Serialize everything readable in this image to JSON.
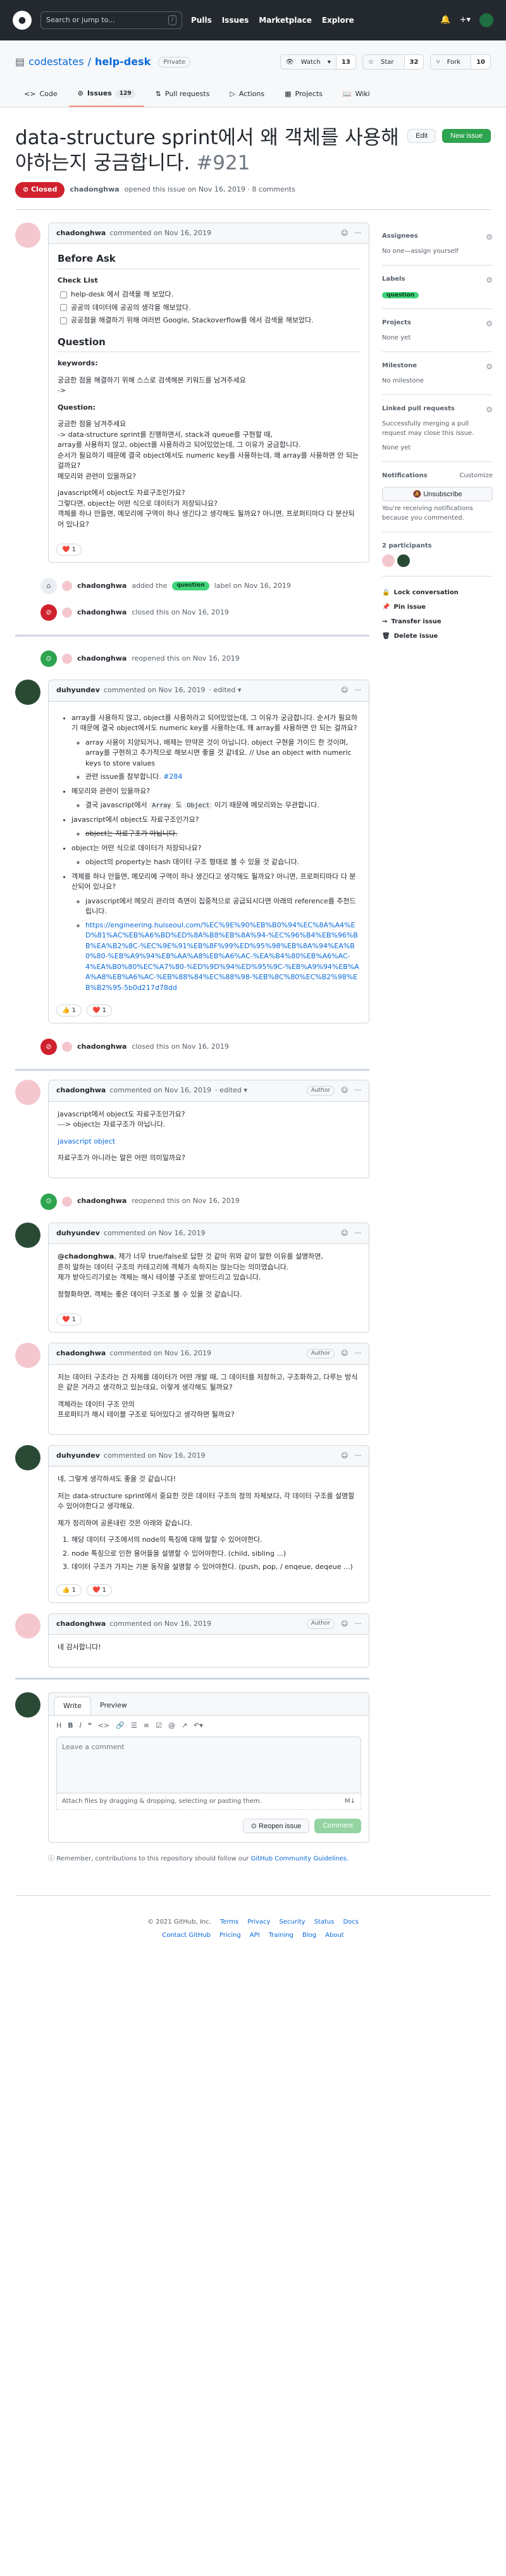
{
  "header": {
    "search_placeholder": "Search or jump to...",
    "search_key": "/",
    "nav": [
      "Pulls",
      "Issues",
      "Marketplace",
      "Explore"
    ]
  },
  "repo": {
    "owner": "codestates",
    "sep": "/",
    "name": "help-desk",
    "visibility": "Private",
    "watch": "Watch",
    "watch_count": "13",
    "star": "Star",
    "star_count": "32",
    "fork": "Fork",
    "fork_count": "10"
  },
  "tabs": [
    {
      "label": "Code"
    },
    {
      "label": "Issues",
      "count": "129"
    },
    {
      "label": "Pull requests"
    },
    {
      "label": "Actions"
    },
    {
      "label": "Projects"
    },
    {
      "label": "Wiki"
    }
  ],
  "issue": {
    "title": "data-structure sprint에서 왜 객체를 사용해야하는지 궁금합니다.",
    "number": "#921",
    "edit": "Edit",
    "new_issue": "New issue",
    "state": "Closed",
    "author": "chadonghwa",
    "opened_text": "opened this issue on Nov 16, 2019 · 8 comments"
  },
  "c1": {
    "author": "chadonghwa",
    "when": "commented on Nov 16, 2019",
    "h_before": "Before Ask",
    "h_checklist": "Check List",
    "checks": [
      "help-desk 에서 검색을 해 보았다.",
      "공공의 데이터에 공공의 생각을 해보았다.",
      "공공점을 해결하기 위해 여러번 Google, Stackoverflow를 에서 검색을 해보았다."
    ],
    "h_question": "Question",
    "kw_label": "keywords:",
    "kw_text": "궁금한 점을 해결하기 위해 스스로 검색해본 키워드를 남겨주세요",
    "kw_arrow": "->",
    "q_label": "Question:",
    "q_lines": [
      "궁금한 점을 남겨주세요",
      "-> data-structure sprint를 진행하면서, stack과 queue를 구현할 때,",
      "array를 사용하지 않고, object를 사용하라고 되어있었는데, 그 이유가 궁금합니다.",
      "순서가 필요하기 때문에 결국 object에서도 numeric key를 사용하는데, 왜 array를 사용하면 안 되는 걸까요?",
      "메모리와 관련이 있을까요?"
    ],
    "q2_lines": [
      "javascript에서 object도 자료구조인가요?",
      "그렇다면, object는 어떤 식으로 데이터가 저장되나요?",
      "객체를 하나 만들면, 메모리에 구역이 하나 생긴다고 생각해도 될까요? 아니면, 프로퍼티마다 다 분산되어 있나요?"
    ],
    "react_count": "1"
  },
  "ev1": {
    "actor": "chadonghwa",
    "text": "added the",
    "label": "question",
    "suffix": "label on Nov 16, 2019"
  },
  "ev2": {
    "actor": "chadonghwa",
    "text": "closed this on Nov 16, 2019"
  },
  "ev3": {
    "actor": "chadonghwa",
    "text": "reopened this on Nov 16, 2019"
  },
  "c2": {
    "author": "duhyundev",
    "when": "commented on Nov 16, 2019",
    "edited": "· edited ▾",
    "b1": "array를 사용하지 않고, object를 사용하라고 되어있었는데, 그 이유가 궁금합니다. 순서가 필요하기 때문에 결국 object에서도 numeric key를 사용하는데, 왜 array를 사용하면 안 되는 걸까요?",
    "b1_sub1": "array 사용이 지양되거나, 배제는 만약은 것이 아닙니다. object 구현을 가이드 한 것이며, array를 구현하고 추가적으로 해보시면 좋을 것 같네요. // Use an object with numeric keys to store values",
    "b1_sub2": "관련 issue를 참부합니다.",
    "b1_link": "#284",
    "b2": "메모리와 관련이 있을까요?",
    "b2_sub_pre": "결국 javascript에서",
    "b2_code1": "Array",
    "b2_mid": "도",
    "b2_code2": "Object",
    "b2_post": "이기 때문에 메모리와는 무관합니다.",
    "b3": "javascript에서 object도 자료구조인가요?",
    "b3_sub": "object는 자료구조가 아닙니다.",
    "b4": "object는 어떤 식으로 데이터가 저장되나요?",
    "b4_sub": "object의 property는 hash 데이터 구조 형태로 볼 수 있을 것 같습니다.",
    "b5": "객체를 하나 만들면, 메모리에 구역이 하나 생긴다고 생각해도 될까요? 아니면, 프로퍼티마다 다 분산되어 있나요?",
    "b5_sub": "javascript에서 메모리 관리의 측면이 집중적으로 공급되시다면 아래의 reference를 추천드립니다.",
    "b5_link": "https://engineering.huiseoul.com/%EC%9E%90%EB%B0%94%EC%8A%A4%ED%81%AC%EB%A6%BD%ED%8A%B8%EB%8A%94-%EC%96%B4%EB%96%BB%EA%B2%8C-%EC%9E%91%EB%8F%99%ED%95%98%EB%8A%94%EA%B0%80-%EB%A9%94%EB%AA%A8%EB%A6%AC-%EA%B4%80%EB%A6%AC-4%EA%B0%80%EC%A7%80-%ED%9D%94%ED%95%9C-%EB%A9%94%EB%AA%A8%EB%A6%AC-%EB%88%84%EC%88%98-%EB%8C%80%EC%B2%98%EB%B2%95-5b0d217d78dd",
    "react_a": "1",
    "react_b": "1"
  },
  "ev4": {
    "actor": "chadonghwa",
    "text": "closed this on Nov 16, 2019"
  },
  "c3": {
    "author": "chadonghwa",
    "when": "commented on Nov 16, 2019",
    "edited": "· edited ▾",
    "badge": "Author",
    "l1": "javascript에서 object도 자료구조인가요?",
    "l2": "---> object는 자료구조가 아닙니다.",
    "link": "javascript object",
    "l3": "자료구조가 아니라는 말은 어떤 의미일까요?"
  },
  "ev5": {
    "actor": "chadonghwa",
    "text": "reopened this on Nov 16, 2019"
  },
  "c4": {
    "author": "duhyundev",
    "when": "commented on Nov 16, 2019",
    "mention": "@chadonghwa",
    "p1": ", 제가 너무 true/false로 답한 것 같아 위와 같이 말한 이유를 설명하면,",
    "p2": "흔히 말하는 데이터 구조의 카테고리에 객체가 속하지는 않는다는 의미였습니다.",
    "p3": "제가 받아드리기로는 객체는 해시 테이블 구조로 받아드리고 있습니다.",
    "p4": "정형화하면, 객체는 좋은 데이터 구조로 볼 수 있을 것 같습니다.",
    "react": "1"
  },
  "c5": {
    "author": "chadonghwa",
    "when": "commented on Nov 16, 2019",
    "badge": "Author",
    "p1": "저는 데이터 구조라는 건 자체를 데이터가 어떤 개발 때, 그 데이터를 저장하고, 구조화하고, 다루는 방식은 같은 거라고 생각하고 있는데요, 이렇게 생각해도 될까요?",
    "p2": "객체라는 데이터 구조 안의",
    "p3": "프로퍼티가 해시 테이블 구조로 되어있다고 생각하면 될까요?"
  },
  "c6": {
    "author": "duhyundev",
    "when": "commented on Nov 16, 2019",
    "p1": "네, 그렇게 생각하셔도 좋을 것 같습니다!",
    "p2": "저는 data-structure sprint에서 중요한 것은 데이터 구조의 정의 자체보다, 각 데이터 구조를 설명할 수 있어야한다고 생각해요.",
    "p3": "제가 정리하여 공론내린 것은 아래와 같습니다.",
    "items": [
      "해당 데이터 구조에서의 node의 특징에 대해 말할 수 있어야한다.",
      "node 특징으로 인한 용어들을 설명할 수 있어야한다. (child, sibling ...)",
      "데이터 구조가 가지는 기본 동작을 설명할 수 있어야한다. (push, pop, / enqeue, deqeue ...)"
    ],
    "react_a": "1",
    "react_b": "1"
  },
  "c7": {
    "author": "chadonghwa",
    "when": "commented on Nov 16, 2019",
    "badge": "Author",
    "p1": "네 감사합니다!"
  },
  "composer": {
    "write": "Write",
    "preview": "Preview",
    "placeholder": "Leave a comment",
    "attach": "Attach files by dragging & dropping, selecting or pasting them.",
    "reopen": "Reopen issue",
    "comment": "Comment",
    "remember": "Remember, contributions to this repository should follow our",
    "guidelines": "GitHub Community Guidelines."
  },
  "sidebar": {
    "assignees": "Assignees",
    "assignees_v": "No one—assign yourself",
    "labels": "Labels",
    "label": "question",
    "projects": "Projects",
    "projects_v": "None yet",
    "milestone": "Milestone",
    "milestone_v": "No milestone",
    "linked": "Linked pull requests",
    "linked_v": "Successfully merging a pull request may close this issue.",
    "linked_v2": "None yet",
    "notifications": "Notifications",
    "customize": "Customize",
    "unsub": "Unsubscribe",
    "notif_v": "You're receiving notifications because you commented.",
    "participants": "2 participants",
    "lock": "Lock conversation",
    "pin": "Pin issue",
    "transfer": "Transfer issue",
    "delete": "Delete issue"
  },
  "footer": {
    "copy": "© 2021 GitHub, Inc.",
    "row1": [
      "Terms",
      "Privacy",
      "Security",
      "Status",
      "Docs"
    ],
    "row2": [
      "Contact GitHub",
      "Pricing",
      "API",
      "Training",
      "Blog",
      "About"
    ]
  }
}
